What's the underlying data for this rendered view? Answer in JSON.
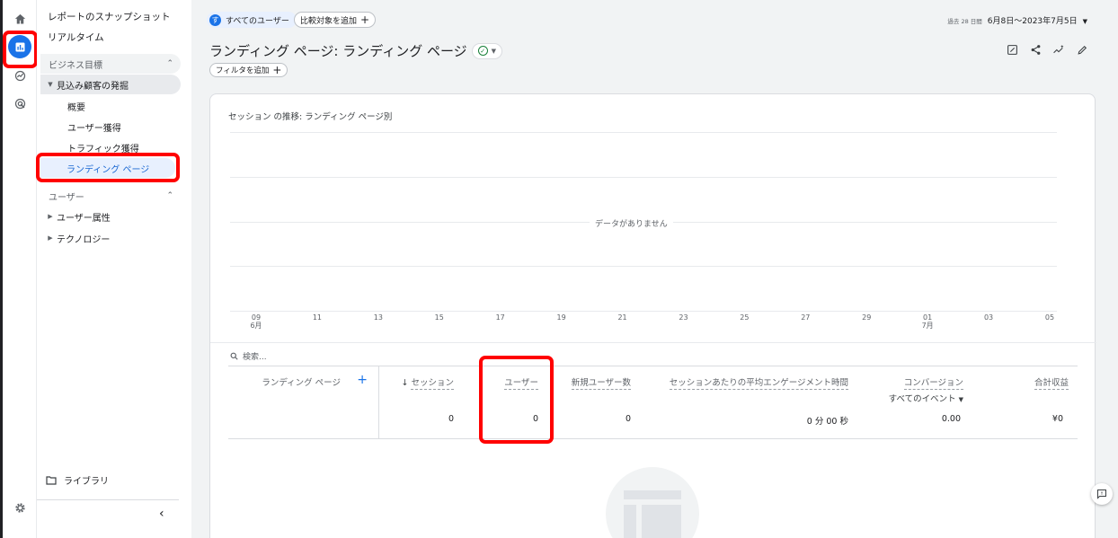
{
  "sidebar": {
    "snapshot": "レポートのスナップショット",
    "realtime": "リアルタイム",
    "section_business": "ビジネス目標",
    "group_leads": "見込み顧客の発掘",
    "sub_overview": "概要",
    "sub_user_acq": "ユーザー獲得",
    "sub_traffic_acq": "トラフィック獲得",
    "sub_landing": "ランディング ページ",
    "section_user": "ユーザー",
    "group_attributes": "ユーザー属性",
    "group_tech": "テクノロジー",
    "library": "ライブラリ"
  },
  "header": {
    "segment_avatar": "す",
    "segment_label": "すべてのユーザー",
    "compare_label": "比較対象を追加",
    "date_prefix": "過去 28 日間",
    "date_range": "6月8日～2023年7月5日",
    "title": "ランディング ページ: ランディング ページ",
    "filter_label": "フィルタを追加"
  },
  "chart": {
    "title": "セッション の推移: ランディング ページ別",
    "no_data": "データがありません",
    "ticks": [
      {
        "d": "09",
        "m": "6月"
      },
      {
        "d": "11",
        "m": ""
      },
      {
        "d": "13",
        "m": ""
      },
      {
        "d": "15",
        "m": ""
      },
      {
        "d": "17",
        "m": ""
      },
      {
        "d": "19",
        "m": ""
      },
      {
        "d": "21",
        "m": ""
      },
      {
        "d": "23",
        "m": ""
      },
      {
        "d": "25",
        "m": ""
      },
      {
        "d": "27",
        "m": ""
      },
      {
        "d": "29",
        "m": ""
      },
      {
        "d": "01",
        "m": "7月"
      },
      {
        "d": "03",
        "m": ""
      },
      {
        "d": "05",
        "m": ""
      }
    ]
  },
  "table": {
    "search_placeholder": "検索...",
    "dimension_header": "ランディング ページ",
    "sessions_header": "セッション",
    "users_header": "ユーザー",
    "new_users_header": "新規ユーザー数",
    "engagement_header": "セッションあたりの平均エンゲージメント時間",
    "conversions_header": "コンバージョン",
    "conversions_sub": "すべてのイベント",
    "revenue_header": "合計収益",
    "sessions_total": "0",
    "users_total": "0",
    "new_users_total": "0",
    "engagement_total": "0 分 00 秒",
    "conversions_total": "0.00",
    "revenue_total": "¥0"
  }
}
